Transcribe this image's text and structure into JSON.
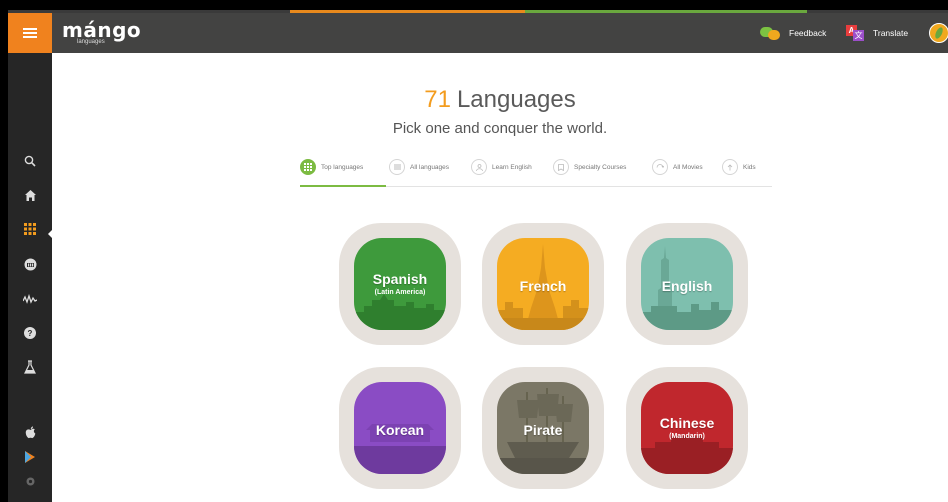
{
  "brand": {
    "name": "mángo",
    "sub": "languages"
  },
  "topbar": {
    "feedback": "Feedback",
    "translate": "Translate",
    "translate_icon_a": "A",
    "translate_icon_b": "文"
  },
  "sidebar": {
    "icons": [
      "search-icon",
      "home-icon",
      "grid-icon",
      "course-icon",
      "waveform-icon",
      "help-icon",
      "flask-icon",
      "apple-icon",
      "play-store-icon",
      "settings-icon"
    ],
    "active": "grid-icon"
  },
  "page": {
    "count": "71",
    "title": "Languages",
    "subtitle": "Pick one and conquer the world."
  },
  "tabs": [
    {
      "label": "Top languages",
      "icon": "grid-icon",
      "active": true
    },
    {
      "label": "All languages",
      "icon": "list-icon",
      "active": false
    },
    {
      "label": "Learn English",
      "icon": "person-icon",
      "active": false
    },
    {
      "label": "Specialty Courses",
      "icon": "bookmark-icon",
      "active": false
    },
    {
      "label": "All Movies",
      "icon": "refresh-icon",
      "active": false
    },
    {
      "label": "Kids",
      "icon": "upload-icon",
      "active": false
    }
  ],
  "languages": [
    {
      "name": "Spanish",
      "detail": "(Latin America)",
      "color": "#3e9a3c",
      "band": "#2f7f2e"
    },
    {
      "name": "French",
      "detail": "",
      "color": "#f5ac22",
      "band": "#d4911b"
    },
    {
      "name": "English",
      "detail": "",
      "color": "#7ebfae",
      "band": "#5d9a86"
    },
    {
      "name": "Korean",
      "detail": "",
      "color": "#8a4cc4",
      "band": "#6e3a9e"
    },
    {
      "name": "Pirate",
      "detail": "",
      "color": "#7b7766",
      "band": "#5f5c4f"
    },
    {
      "name": "Chinese",
      "detail": "(Mandarin)",
      "color": "#c0272d",
      "band": "#9a1f24"
    }
  ]
}
